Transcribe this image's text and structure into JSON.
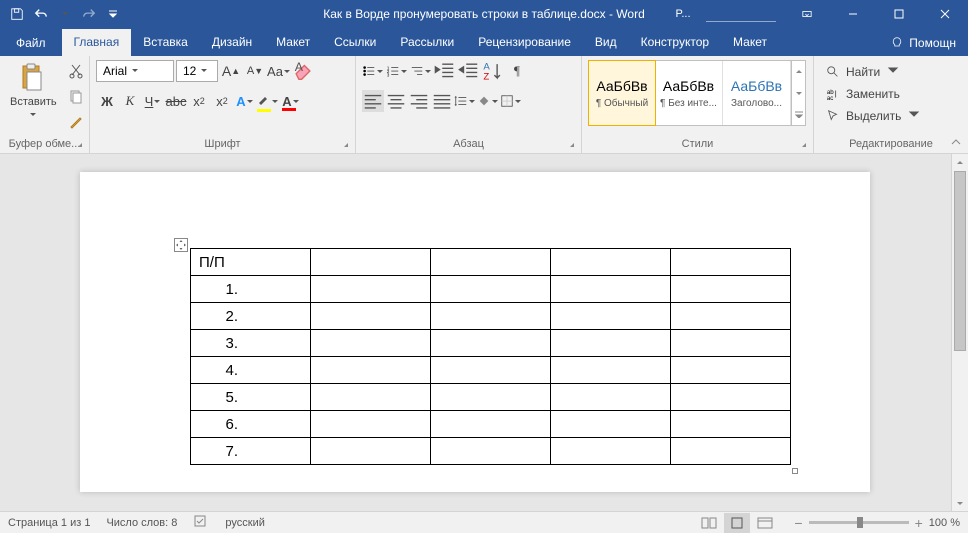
{
  "titlebar": {
    "title": "Как в Ворде пронумеровать строки в таблице.docx - Word",
    "account_short": "P..."
  },
  "tabs": {
    "file": "Файл",
    "home": "Главная",
    "insert": "Вставка",
    "design": "Дизайн",
    "layout": "Макет",
    "references": "Ссылки",
    "mailings": "Рассылки",
    "review": "Рецензирование",
    "view": "Вид",
    "table_design": "Конструктор",
    "table_layout": "Макет",
    "help": "Помощн"
  },
  "ribbon": {
    "clipboard": {
      "paste": "Вставить",
      "label": "Буфер обме..."
    },
    "font": {
      "name": "Arial",
      "size": "12",
      "bold": "Ж",
      "italic": "К",
      "underline": "Ч",
      "strike": "abc",
      "case": "Aa",
      "label": "Шрифт"
    },
    "paragraph": {
      "label": "Абзац"
    },
    "styles": {
      "preview": "АаБбВв",
      "normal": "¶ Обычный",
      "nospacing": "¶ Без инте...",
      "heading1": "Заголово...",
      "label": "Стили"
    },
    "editing": {
      "find": "Найти",
      "replace": "Заменить",
      "select": "Выделить",
      "label": "Редактирование"
    }
  },
  "document": {
    "table": {
      "header": "П/П",
      "rows": [
        "1.",
        "2.",
        "3.",
        "4.",
        "5.",
        "6.",
        "7."
      ]
    }
  },
  "statusbar": {
    "page": "Страница 1 из 1",
    "words": "Число слов: 8",
    "lang": "русский",
    "zoom": "100 %"
  }
}
